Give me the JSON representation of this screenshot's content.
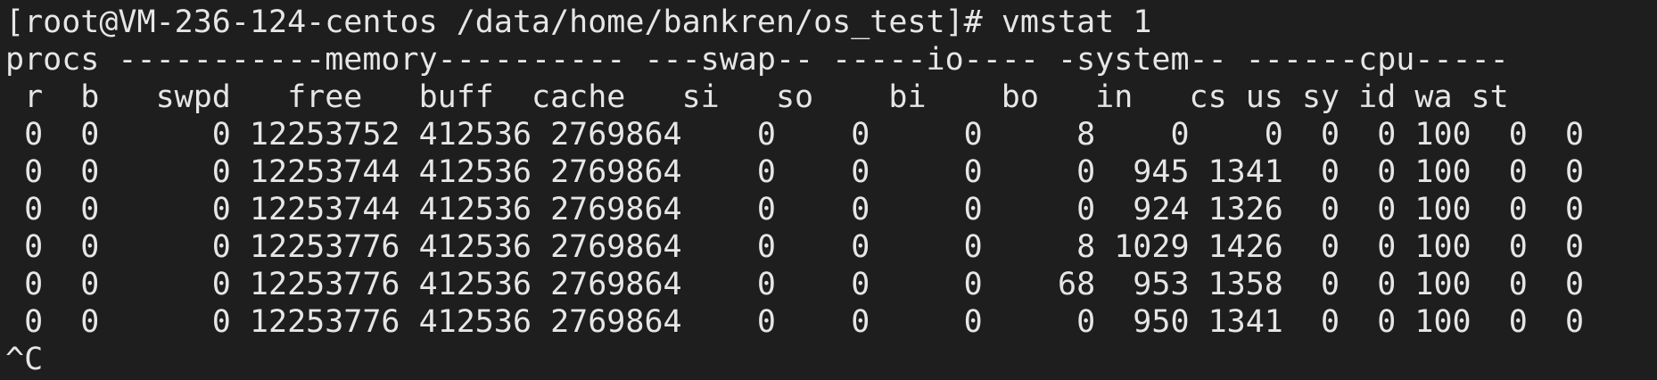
{
  "terminal": {
    "prompt": "[root@VM-236-124-centos /data/home/bankren/os_test]# ",
    "command": "vmstat 1",
    "header_groups": "procs -----------memory---------- ---swap-- -----io---- -system-- ------cpu-----",
    "header_columns": " r  b   swpd   free   buff  cache   si   so    bi    bo   in   cs us sy id wa st",
    "rows": [
      " 0  0      0 12253752 412536 2769864    0    0     0     8    0    0  0  0 100  0  0",
      " 0  0      0 12253744 412536 2769864    0    0     0     0  945 1341  0  0 100  0  0",
      " 0  0      0 12253744 412536 2769864    0    0     0     0  924 1326  0  0 100  0  0",
      " 0  0      0 12253776 412536 2769864    0    0     0     8 1029 1426  0  0 100  0  0",
      " 0  0      0 12253776 412536 2769864    0    0     0    68  953 1358  0  0 100  0  0",
      " 0  0      0 12253776 412536 2769864    0    0     0     0  950 1341  0  0 100  0  0"
    ],
    "interrupt": "^C"
  },
  "colors": {
    "background": "#1e1e1e",
    "foreground": "#e6e6e6"
  }
}
